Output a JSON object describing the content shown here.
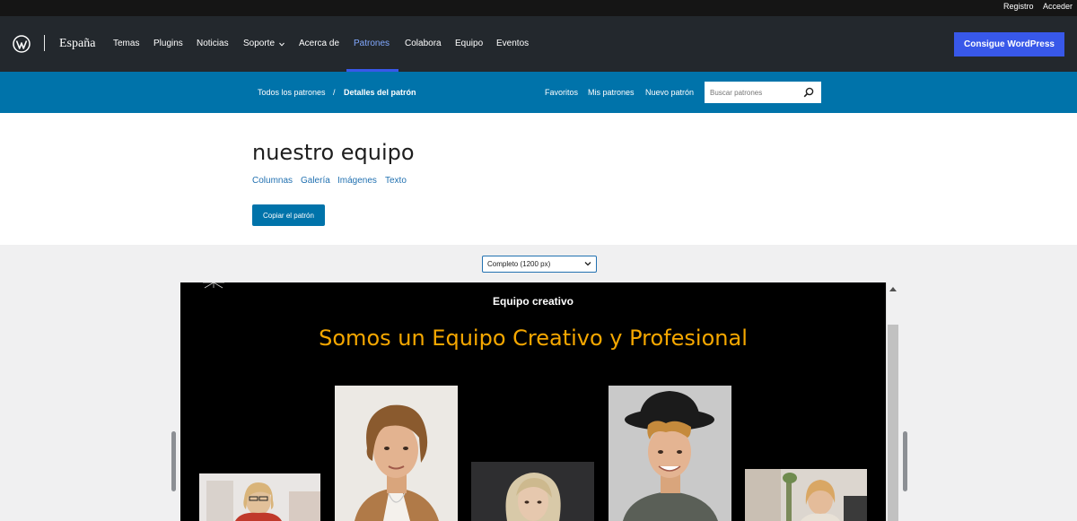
{
  "topbar": {
    "register": "Registro",
    "login": "Acceder"
  },
  "nav": {
    "site_name": "España",
    "items": [
      "Temas",
      "Plugins",
      "Noticias",
      "Soporte",
      "Acerca de",
      "Patrones",
      "Colabora",
      "Equipo",
      "Eventos"
    ],
    "active": "Patrones",
    "cta": "Consigue WordPress"
  },
  "subnav": {
    "breadcrumb_all": "Todos los patrones",
    "breadcrumb_sep": "/",
    "breadcrumb_current": "Detalles del patrón",
    "links": [
      "Favoritos",
      "Mis patrones",
      "Nuevo patrón"
    ],
    "search_placeholder": "Buscar patrones"
  },
  "pattern": {
    "title": "nuestro equipo",
    "categories": [
      "Columnas",
      "Galería",
      "Imágenes",
      "Texto"
    ],
    "copy_button": "Copiar el patrón"
  },
  "preview": {
    "width_select": "Completo (1200 px)",
    "eyebrow": "Equipo creativo",
    "heading": "Somos un Equipo Creativo y Profesional"
  },
  "colors": {
    "admin_bar": "#151515",
    "nav_bg": "#23282d",
    "accent_blue": "#3858e9",
    "subnav_blue": "#0073aa",
    "heading_orange": "#f5a700"
  },
  "icons": [
    "wordpress-logo-icon",
    "chevron-down-icon",
    "search-icon",
    "sparkle-icon"
  ]
}
